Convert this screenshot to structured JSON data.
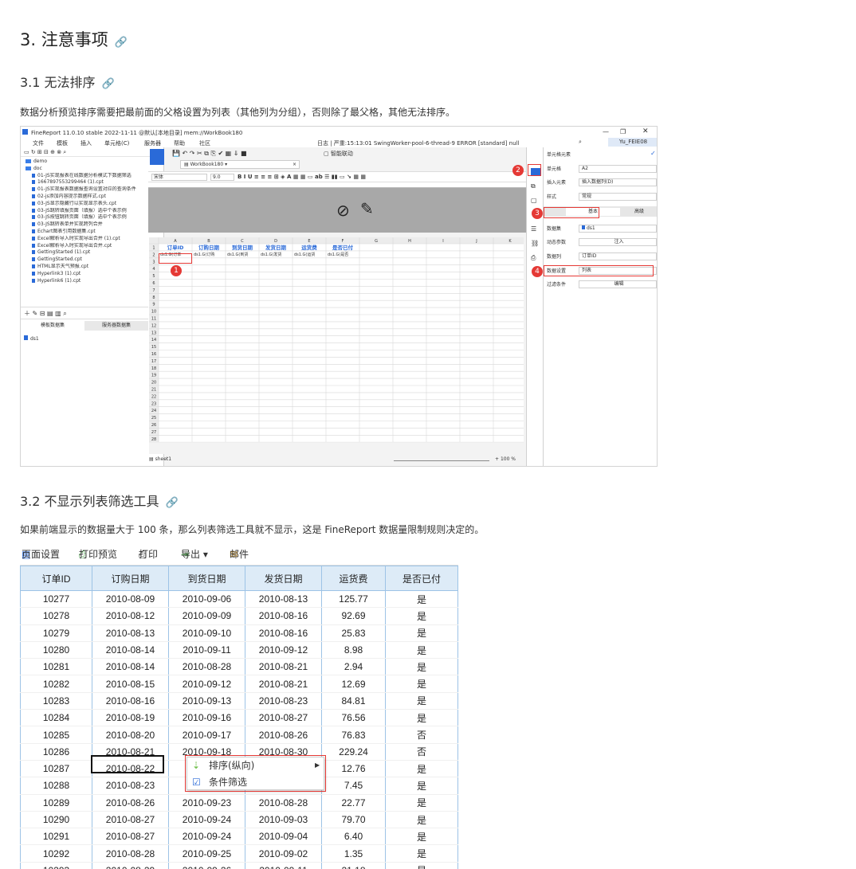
{
  "headings": {
    "h2": "3. 注意事项",
    "h3_1": "3.1 无法排序",
    "h3_2": "3.2 不显示列表筛选工具"
  },
  "paragraphs": {
    "p1": "数据分析预览排序需要把最前面的父格设置为列表（其他列为分组），否则除了最父格，其他无法排序。",
    "p2": "如果前端显示的数据量大于 100 条，那么列表筛选工具就不显示，这是 FineReport 数据量限制规则决定的。"
  },
  "designer": {
    "window_title": "FineReport 11.0.10 stable 2022-11-11 @默认[本地目录]    mem://WorkBook180",
    "status": "日志 | 严重:15:13:01 SwingWorker-pool-6-thread-9 ERROR [standard] null",
    "menu": [
      "文件",
      "模板",
      "插入",
      "单元格(C)",
      "服务器",
      "帮助",
      "社区"
    ],
    "tab": "WorkBook180 ▾",
    "font_name": "宋体",
    "font_size": "9.0",
    "tree": [
      "demo",
      "doc",
      "01-JS实现报表在线数据分析模式下数据筛选",
      "1667897553299464 (1).cpt",
      "01-JS实现报表数据报查询设置对应的查询条件",
      "02-js添加内容提示数据样式.cpt",
      "03-JS显示隐藏行以实现显示表头.cpt",
      "03-JS跳转填报页面（填报）选中个表示例",
      "03-JS按钮跳转页面（填报）选中个表示例",
      "03-JS跳转表单并实现跨列合并",
      "Echart图表引用数据集.cpt",
      "Excel解析导入时实现导出合并 (1).cpt",
      "Excel解析导入时实现导出合并.cpt",
      "GettingStarted (1).cpt",
      "GettingStarted.cpt",
      "HTML显示天气预报.cpt",
      "Hyperlink3 (1).cpt",
      "Hyperlink6 (1).cpt"
    ],
    "ds_tabs": [
      "模板数据集",
      "服务器数据集"
    ],
    "ds_item": "ds1",
    "col_letters": [
      "A",
      "B",
      "C",
      "D",
      "E",
      "F",
      "G",
      "H",
      "I",
      "J",
      "K"
    ],
    "row1": [
      "订单ID",
      "订购日期",
      "到货日期",
      "发货日期",
      "运货费",
      "是否已付"
    ],
    "row2": [
      "ds1.G(订单",
      "ds1.G(订购",
      "ds1.G(到货",
      "ds1.G(发货",
      "ds1.G(运货",
      "ds1.G(是否"
    ],
    "sheet_tab": "sheet1",
    "zoom": "100",
    "panel_title": "单元格元素",
    "props": {
      "cell_label": "单元格",
      "cell_value": "A2",
      "insert_label": "插入元素",
      "insert_value": "插入数据列(D)",
      "style_label": "样式",
      "style_value": "常规",
      "tab_basic": "基本",
      "tab_advanced": "高级",
      "ds_label": "数据集",
      "ds_value": "ds1",
      "dyn_label": "动态参数",
      "dyn_value": "注入",
      "col_label": "数据列",
      "col_value": "订单ID",
      "setting_label": "数据设置",
      "setting_value": "列表",
      "filter_label": "过滤条件",
      "filter_value": "编辑"
    },
    "user": "Yu_FEIE08",
    "marker": "智能联动"
  },
  "preview": {
    "toolbar": [
      "页面设置",
      "打印预览",
      "打印",
      "导出 ▾",
      "邮件"
    ],
    "columns": [
      "订单ID",
      "订购日期",
      "到货日期",
      "发货日期",
      "运货费",
      "是否已付"
    ],
    "rows": [
      [
        "10277",
        "2010-08-09",
        "2010-09-06",
        "2010-08-13",
        "125.77",
        "是"
      ],
      [
        "10278",
        "2010-08-12",
        "2010-09-09",
        "2010-08-16",
        "92.69",
        "是"
      ],
      [
        "10279",
        "2010-08-13",
        "2010-09-10",
        "2010-08-16",
        "25.83",
        "是"
      ],
      [
        "10280",
        "2010-08-14",
        "2010-09-11",
        "2010-09-12",
        "8.98",
        "是"
      ],
      [
        "10281",
        "2010-08-14",
        "2010-08-28",
        "2010-08-21",
        "2.94",
        "是"
      ],
      [
        "10282",
        "2010-08-15",
        "2010-09-12",
        "2010-08-21",
        "12.69",
        "是"
      ],
      [
        "10283",
        "2010-08-16",
        "2010-09-13",
        "2010-08-23",
        "84.81",
        "是"
      ],
      [
        "10284",
        "2010-08-19",
        "2010-09-16",
        "2010-08-27",
        "76.56",
        "是"
      ],
      [
        "10285",
        "2010-08-20",
        "2010-09-17",
        "2010-08-26",
        "76.83",
        "否"
      ],
      [
        "10286",
        "2010-08-21",
        "2010-09-18",
        "2010-08-30",
        "229.24",
        "否"
      ],
      [
        "10287",
        "2010-08-22",
        "",
        "",
        "12.76",
        "是"
      ],
      [
        "10288",
        "2010-08-23",
        "",
        "",
        "7.45",
        "是"
      ],
      [
        "10289",
        "2010-08-26",
        "2010-09-23",
        "2010-08-28",
        "22.77",
        "是"
      ],
      [
        "10290",
        "2010-08-27",
        "2010-09-24",
        "2010-09-03",
        "79.70",
        "是"
      ],
      [
        "10291",
        "2010-08-27",
        "2010-09-24",
        "2010-09-04",
        "6.40",
        "是"
      ],
      [
        "10292",
        "2010-08-28",
        "2010-09-25",
        "2010-09-02",
        "1.35",
        "是"
      ],
      [
        "10293",
        "2010-08-29",
        "2010-09-26",
        "2010-09-11",
        "21.18",
        "是"
      ]
    ],
    "context_menu": [
      "排序(纵向)",
      "条件筛选"
    ]
  },
  "colors": {
    "accent": "#2a6ad8",
    "marker_red": "#e53935",
    "header_bg": "#ddebf7",
    "border_blue": "#9dc3e6"
  }
}
